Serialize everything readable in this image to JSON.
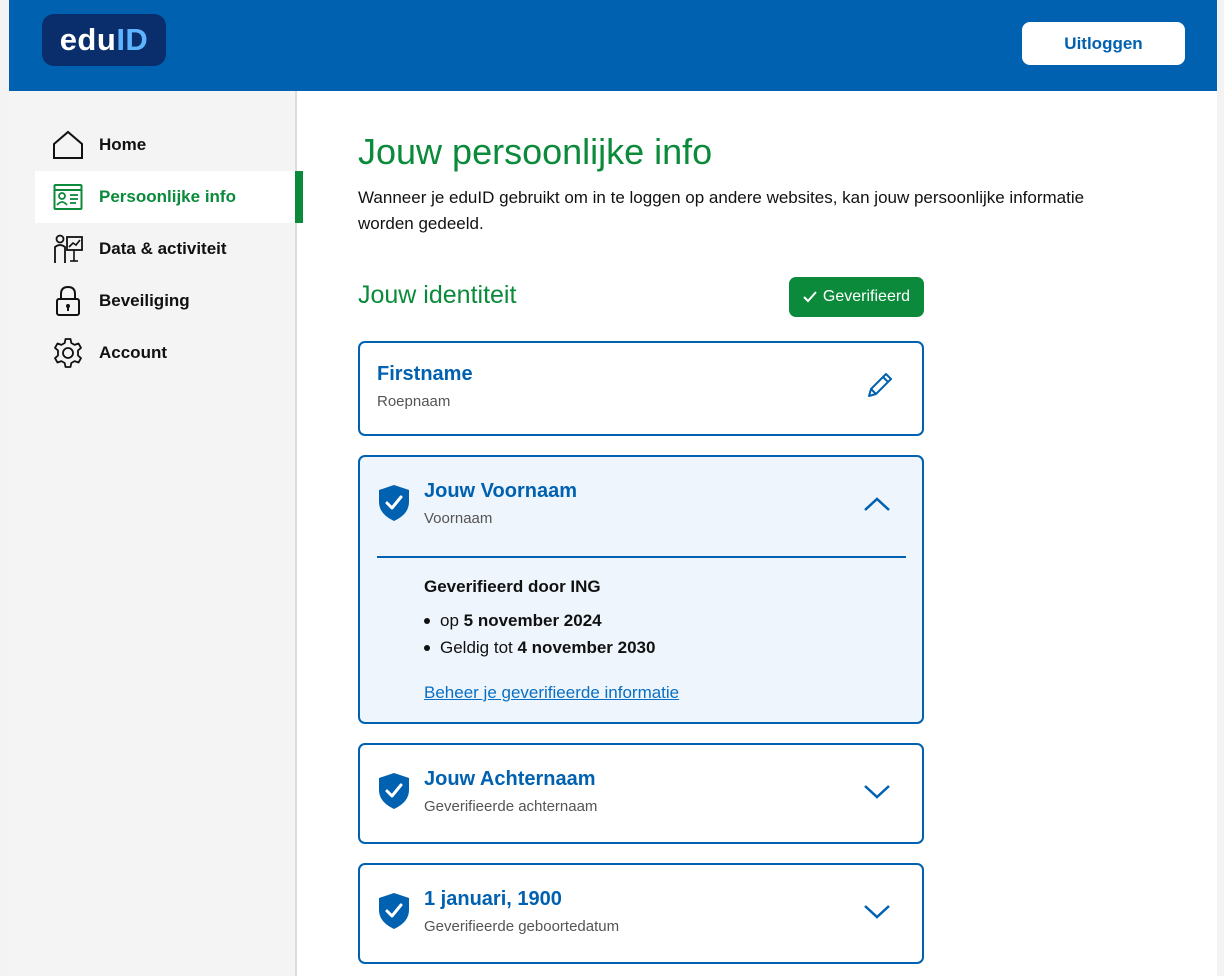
{
  "header": {
    "logo_edu": "edu",
    "logo_id": "ID",
    "logout_label": "Uitloggen"
  },
  "sidebar": {
    "items": [
      {
        "label": "Home",
        "icon": "home-icon"
      },
      {
        "label": "Persoonlijke info",
        "icon": "id-card-icon",
        "active": true
      },
      {
        "label": "Data & activiteit",
        "icon": "presentation-icon"
      },
      {
        "label": "Beveiliging",
        "icon": "lock-icon"
      },
      {
        "label": "Account",
        "icon": "gear-icon"
      }
    ]
  },
  "main": {
    "title": "Jouw persoonlijke info",
    "intro": "Wanneer je eduID gebruikt om in te loggen op andere websites, kan jouw persoonlijke informatie worden gedeeld.",
    "identity_title": "Jouw identiteit",
    "verified_badge": "Geverifieerd",
    "cards": [
      {
        "title": "Firstname",
        "subtitle": "Roepnaam",
        "action_icon": "pencil-icon"
      },
      {
        "title": "Jouw Voornaam",
        "subtitle": "Voornaam",
        "expanded": true,
        "verified_by": "Geverifieerd door ING",
        "detail_1_prefix": "op",
        "detail_1_value": "5 november 2024",
        "detail_2_prefix": "Geldig tot",
        "detail_2_value": "4 november 2030",
        "manage_link": "Beheer je geverifieerde informatie"
      },
      {
        "title": "Jouw Achternaam",
        "subtitle": "Geverifieerde achternaam"
      },
      {
        "title": "1 januari, 1900",
        "subtitle": "Geverifieerde geboortedatum"
      }
    ]
  },
  "colors": {
    "brand_blue": "#0061b0",
    "brand_green": "#0a8a3a",
    "logo_navy": "#0a2d6b"
  }
}
